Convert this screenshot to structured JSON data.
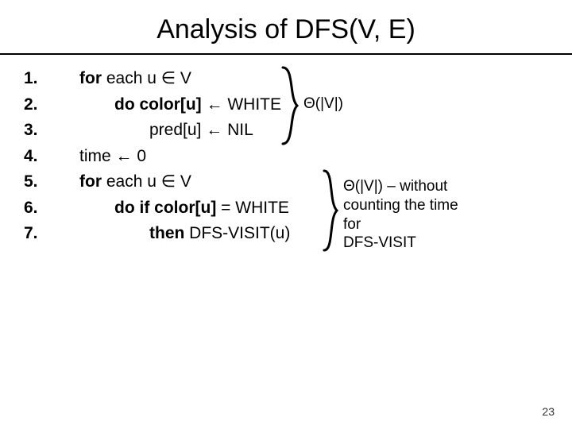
{
  "title": "Analysis of DFS(V, E)",
  "lines": [
    {
      "num": "1.",
      "indent": 0,
      "code_html": "<span class='bold'>for</span> <span class='plain'>each</span> u ∈ V"
    },
    {
      "num": "2.",
      "indent": 1,
      "code_html": "<span class='bold'>do color[u]</span> ← <span class='plain'>WHITE</span>"
    },
    {
      "num": "3.",
      "indent": 2,
      "code_html": "pred[u] ← <span class='plain'>NIL</span>"
    },
    {
      "num": "4.",
      "indent": 0,
      "code_html": "time ← 0"
    },
    {
      "num": "5.",
      "indent": 0,
      "code_html": "<span class='bold'>for</span> <span class='plain'>each</span> u ∈ V"
    },
    {
      "num": "6.",
      "indent": 1,
      "code_html": "<span class='bold'>do if color[u]</span> = <span class='plain'>WHITE</span>"
    },
    {
      "num": "7.",
      "indent": 2,
      "code_html": "<span class='bold'>then</span> <span class='plain'>DFS-VISIT(u)</span>"
    }
  ],
  "annot1": "Θ(|V|)",
  "annot2": "Θ(|V|) – without counting the time for          DFS-VISIT",
  "annot2_lines": [
    "Θ(|V|) – without",
    "counting the time",
    "for",
    "DFS-VISIT"
  ],
  "page_number": "23"
}
